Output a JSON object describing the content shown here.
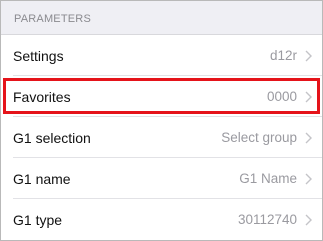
{
  "section": {
    "title": "PARAMETERS"
  },
  "rows": [
    {
      "label": "Settings",
      "value": "d12r",
      "icon": "chevron-right-icon"
    },
    {
      "label": "Favorites",
      "value": "0000",
      "icon": "chevron-right-icon",
      "highlight_color": "#e5131a"
    },
    {
      "label": "G1 selection",
      "value": "Select group",
      "icon": "chevron-right-icon"
    },
    {
      "label": "G1 name",
      "value": "G1 Name",
      "icon": "chevron-right-icon"
    },
    {
      "label": "G1 type",
      "value": "30112740",
      "icon": "chevron-right-icon"
    }
  ],
  "colors": {
    "header_background": "#efeff4",
    "highlight": "#e5131a",
    "value_text": "#9a9aa0",
    "chevron": "#c4c4c8"
  }
}
